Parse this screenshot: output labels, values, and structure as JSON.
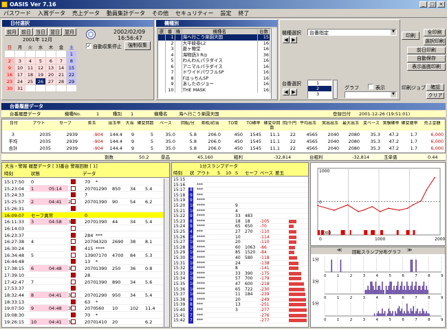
{
  "app": {
    "title": "OASIS Ver 7.16"
  },
  "menu": [
    "パスワード",
    "入賞データ",
    "売上データ",
    "動員集計データ",
    "その他",
    "セキュリティー",
    "設定",
    "終了"
  ],
  "cal_panel": {
    "title": "日付選択",
    "buttons": [
      "前月",
      "前日",
      "当日",
      "翌日",
      "翌月"
    ],
    "month": "2001年 12月",
    "dows": [
      "日",
      "月",
      "火",
      "水",
      "木",
      "金",
      "土"
    ],
    "weeks": [
      [
        "",
        "",
        "",
        "",
        "",
        "",
        "1"
      ],
      [
        "2",
        "3",
        "4",
        "5",
        "6",
        "7",
        "8"
      ],
      [
        "9",
        "10",
        "11",
        "12",
        "13",
        "14",
        "15"
      ],
      [
        "16",
        "17",
        "18",
        "19",
        "20",
        "21",
        "22"
      ],
      [
        "23",
        "24",
        "25",
        "26",
        "27",
        "28",
        "29"
      ],
      [
        "30",
        "31",
        "",
        "",
        "",
        "",
        ""
      ]
    ],
    "date": "2002/02/09",
    "time": "16:56:47",
    "auto_label": "自動収集停止",
    "manual_btn": "強制収集"
  },
  "machine_panel": {
    "title": "機種別",
    "headers": [
      "選",
      "番",
      "機",
      "機種名",
      "台数"
    ],
    "rows": [
      [
        "",
        "1",
        "",
        "海へ行こう楽園天国",
        "15"
      ],
      [
        "",
        "2",
        "",
        "大平綾巻L2",
        "16"
      ],
      [
        "",
        "3",
        "",
        "蒼ヶ穂堂",
        "16"
      ],
      [
        "",
        "4",
        "",
        "海物語3 R◎",
        "36"
      ],
      [
        "",
        "5",
        "",
        "わんわんパラダイス",
        "16"
      ],
      [
        "",
        "6",
        "",
        "アニマルパラダイス",
        "16"
      ],
      [
        "",
        "7",
        "",
        "ドワイドパワフルSP",
        "16"
      ],
      [
        "",
        "8",
        "",
        "FはっちんSP",
        "16"
      ],
      [
        "",
        "9",
        "",
        "あしたのジョー",
        "16"
      ],
      [
        "",
        "10",
        "",
        "THE MASK",
        "16"
      ]
    ]
  },
  "filter_panel": {
    "model_label": "機種選択",
    "model_value": "台番指定",
    "machine_label": "台番選択",
    "graph_label": "グラフ",
    "display_label": "表示",
    "machine_values": [
      "1",
      "2",
      "3"
    ]
  },
  "right_buttons": [
    "印刷",
    "全印刷",
    "選択印刷",
    "前日印刷",
    "自動保存",
    "表示画面印刷",
    "印刷ジョブ",
    "確認",
    "クリア"
  ],
  "history_title": "台番履歴データ",
  "summary": {
    "label1": "台番履歴データ",
    "mno_label": "機種No.",
    "mno": "1",
    "type_label": "種別",
    "type": "1",
    "name_label": "機種名",
    "name": "海へ行こう楽園天国",
    "date_label": "登録日付",
    "date": "2001-12-26 (19:51:01)"
  },
  "sum_headers": [
    "日付",
    "アウト",
    "セーフ",
    "差玉",
    "出玉率",
    "大当",
    "確変回数",
    "ベース",
    "回転/分",
    "差枚/初当",
    "TO単",
    "TO確率",
    "確変中回数",
    "回/千円",
    "平均出玉",
    "実出出玉",
    "最大出玉",
    "変ベース",
    "実験確率",
    "確変継率",
    "売上金額"
  ],
  "sum_rows": [
    [
      "3",
      "2035",
      "2939",
      "-904",
      "144.4",
      "9",
      "5",
      "35.0",
      "5.8",
      "206.0",
      "450",
      "1545",
      "11.1",
      "22",
      "4565",
      "2040",
      "2080",
      "35.3",
      "47.2",
      "1.7",
      "6,000"
    ],
    [
      "平均",
      "2035",
      "2939",
      "-904",
      "144.4",
      "9",
      "5",
      "35.0",
      "5.8",
      "206.0",
      "450",
      "1545",
      "11.1",
      "22",
      "4565",
      "2040",
      "2080",
      "35.3",
      "47.2",
      "1.7",
      "6,000"
    ],
    [
      "合計",
      "2035",
      "2939",
      "-904",
      "144.4",
      "9",
      "5",
      "35.0",
      "5.8",
      "206.0",
      "450",
      "1545",
      "11.1",
      "22",
      "4565",
      "2040",
      "2080",
      "35.3",
      "47.2",
      "1.7",
      "6,000"
    ]
  ],
  "footer": {
    "a": "割数",
    "a_val": "50.2",
    "b": "景品",
    "b_val": "45,160",
    "c": "粗利",
    "c_val": "-32,814",
    "d": "台粗利",
    "d_val": "-32,814",
    "e": "玉単価",
    "e_val": "0.44"
  },
  "events": {
    "title": "大当・警報 履歴データ [ 3]番台 警報回数 [ 1]",
    "headers": [
      "時刻",
      "状態",
      "",
      "",
      "",
      "データ",
      "",
      "",
      "",
      "",
      ""
    ],
    "rows": [
      [
        "15:17:50",
        "0",
        "",
        "",
        "",
        "70",
        "*",
        "",
        "",
        "",
        ""
      ],
      [
        "15:23:04",
        "1",
        "05:14",
        "",
        "",
        "2070",
        "1290",
        "850",
        "34",
        "5.4"
      ],
      [
        "15:24:33",
        "",
        "",
        "",
        "",
        "7",
        "",
        "",
        "",
        "",
        ""
      ],
      [
        "15:25:57",
        "2",
        "04:41",
        "2m",
        "",
        "2070",
        "1390",
        "90",
        "54",
        "6.2"
      ],
      [
        "15:26:31",
        "",
        "",
        "",
        "",
        "",
        "",
        "",
        "",
        "",
        ""
      ],
      [
        "16:09:07",
        "セーフ異常",
        "",
        "",
        "",
        "0",
        "",
        "",
        "",
        "",
        ""
      ],
      [
        "16:11:33",
        "3",
        "04:58",
        "3m",
        "",
        "2070",
        "1390",
        "44",
        "34",
        "5.4"
      ],
      [
        "16:14:03",
        "",
        "",
        "",
        "",
        "",
        "",
        "",
        "",
        "",
        ""
      ],
      [
        "16:23:37",
        "",
        "",
        "",
        "",
        "284",
        "***",
        "",
        "",
        "",
        ""
      ],
      [
        "16:27:38",
        "4",
        "",
        "",
        "",
        "2070",
        "4320",
        "2690",
        "38",
        "8.1"
      ],
      [
        "16:30:24",
        "",
        "",
        "",
        "",
        "415",
        "****",
        "",
        "",
        "",
        ""
      ],
      [
        "16:34:48",
        "5",
        "",
        "",
        "",
        "1390",
        "7170",
        "4700",
        "84",
        "5.3"
      ],
      [
        "16:44:48",
        "",
        "",
        "",
        "",
        "13",
        "*",
        "",
        "",
        "",
        ""
      ],
      [
        "17:38:15",
        "6",
        "04:48",
        "3m",
        "",
        "2070",
        "1390",
        "250",
        "36",
        "0.8"
      ],
      [
        "17:39:10",
        "",
        "",
        "",
        "",
        "28",
        "",
        "",
        "",
        "",
        ""
      ],
      [
        "17:42:47",
        "7",
        "",
        "",
        "",
        "2070",
        "1390",
        "890",
        "34",
        "5.6"
      ],
      [
        "17:53:37",
        "",
        "",
        "",
        "",
        "",
        "",
        "",
        "",
        "",
        ""
      ],
      [
        "18:32:44",
        "8",
        "04:41",
        "3m",
        "",
        "2070",
        "1290",
        "950",
        "34",
        "5.4"
      ],
      [
        "18:33:13",
        "",
        "",
        "",
        "",
        "63",
        "*",
        "",
        "",
        "",
        ""
      ],
      [
        "19:07:50",
        "9",
        "04:48",
        "3m",
        "",
        "2070",
        "560",
        "10",
        "102",
        "11.4"
      ],
      [
        "19:08:30",
        "",
        "",
        "",
        "",
        "70",
        "*",
        "",
        "",
        "",
        ""
      ],
      [
        "19:26:15",
        "10",
        "04:41",
        "3m",
        "",
        "2070",
        "1410",
        "20",
        "",
        "6.2"
      ]
    ],
    "alert_index": 5
  },
  "slump": {
    "title": "1分スランプデータ",
    "headers": [
      "時刻",
      "状",
      "アウト",
      "5",
      "10",
      "S",
      "セーフ",
      "ベース",
      "差玉"
    ],
    "rows": [
      [
        "15:15",
        "1",
        "",
        "",
        "",
        "",
        "",
        "",
        ""
      ],
      [
        "15:16",
        "8",
        "***",
        "",
        "",
        "",
        "",
        "",
        ""
      ],
      [
        "15:17",
        "8",
        "***",
        "",
        "",
        "",
        "",
        "",
        ""
      ],
      [
        "15:18",
        "9",
        "***",
        "",
        "",
        "",
        "",
        "",
        ""
      ],
      [
        "15:19",
        "9",
        "****",
        "",
        "",
        "",
        "",
        "",
        ""
      ],
      [
        "15:20",
        "10",
        "****",
        "",
        "",
        "9",
        "",
        "",
        ""
      ],
      [
        "15:21",
        "10",
        "****",
        "",
        "",
        "4",
        "",
        "",
        ""
      ],
      [
        "15:22",
        "9",
        "****",
        "",
        "",
        "33",
        "483",
        "",
        ""
      ],
      [
        "15:23",
        "8",
        "****",
        "",
        "",
        "18",
        "18",
        "-105",
        ""
      ],
      [
        "15:24",
        "9",
        "****",
        "",
        "",
        "65",
        "650",
        "-70",
        ""
      ],
      [
        "15:25",
        "4",
        "***",
        "",
        "",
        "27",
        "270",
        "-110",
        ""
      ],
      [
        "15:26",
        "10",
        "****",
        "",
        "",
        "10",
        "",
        "-114",
        ""
      ],
      [
        "15:27",
        "10",
        "****",
        "",
        "",
        "20",
        "",
        "-110",
        ""
      ],
      [
        "15:28",
        "10",
        "****",
        "",
        "",
        "60",
        "1063",
        "-86",
        ""
      ],
      [
        "15:29",
        "10",
        "****",
        "",
        "",
        "85",
        "1520",
        "-84",
        ""
      ],
      [
        "15:30",
        "10",
        "****",
        "",
        "",
        "40",
        "580",
        "-118",
        ""
      ],
      [
        "15:31",
        "10",
        "****",
        "",
        "",
        "24",
        "",
        "-138",
        ""
      ],
      [
        "15:32",
        "10",
        "****",
        "",
        "",
        "8",
        "",
        "-141",
        ""
      ],
      [
        "15:33",
        "10",
        "****",
        "",
        "",
        "33",
        "390",
        "-175",
        ""
      ],
      [
        "15:34",
        "10",
        "****",
        "",
        "",
        "57",
        "700",
        "-179",
        ""
      ],
      [
        "15:35",
        "10",
        "****",
        "",
        "",
        "47",
        "600",
        "-218",
        ""
      ],
      [
        "15:36",
        "10",
        "****",
        "",
        "",
        "65",
        "722",
        "-230",
        ""
      ],
      [
        "15:37",
        "10",
        "****",
        "",
        "",
        "11",
        "184",
        "-239",
        ""
      ],
      [
        "15:38",
        "9",
        "****",
        "",
        "",
        "20",
        "",
        "-249",
        ""
      ],
      [
        "15:39",
        "8",
        "***",
        "",
        "",
        "13",
        "",
        "-251",
        ""
      ],
      [
        "15:40",
        "7",
        "***",
        "",
        "",
        "3",
        "",
        "-277",
        ""
      ],
      [
        "15:41",
        "7",
        "***",
        "",
        "",
        "",
        "",
        "-276",
        ""
      ],
      [
        "15:42",
        "7",
        "***",
        "",
        "",
        "",
        "",
        "-277",
        ""
      ]
    ]
  },
  "top_chart": {
    "ylim_labels": [
      "1000",
      "0",
      "-1000"
    ],
    "x_labels": [
      "0",
      "1000",
      "2000"
    ],
    "series": [
      {
        "name": "差玉",
        "x": [
          0,
          60,
          110,
          150,
          170,
          200,
          230,
          260,
          300,
          330,
          350,
          380,
          400,
          430
        ],
        "y": [
          -120,
          -260,
          -100,
          -300,
          -250,
          -150,
          -300,
          -200,
          -260,
          -200,
          -100,
          20,
          350,
          720
        ]
      }
    ]
  },
  "dist": {
    "title": "回転スランプ分布グラフ",
    "rows": [
      {
        "label": "1分",
        "values": [
          0,
          0,
          0,
          0,
          0,
          1,
          0,
          0,
          0,
          0,
          0,
          0,
          1,
          0,
          0,
          0,
          0,
          0,
          0,
          0,
          0,
          0,
          0,
          0,
          0,
          0,
          0,
          0,
          0,
          0,
          0,
          0,
          0,
          0,
          0,
          0,
          0,
          0,
          0,
          0,
          0,
          0,
          0,
          0,
          0,
          0,
          0,
          0,
          0,
          0,
          0,
          0,
          0,
          0,
          0,
          0,
          0,
          0,
          0,
          0,
          0,
          0,
          0,
          0,
          0,
          0,
          1,
          1,
          0,
          0,
          1,
          0,
          0,
          0,
          0,
          0,
          0,
          0,
          0,
          0,
          0,
          0,
          0,
          0,
          0,
          0,
          0,
          0,
          0,
          0
        ]
      },
      {
        "label": "3分",
        "values": [
          0,
          0,
          0,
          0,
          0,
          0,
          0,
          0,
          0,
          0,
          0,
          0,
          0,
          0,
          0,
          0,
          0,
          0,
          0,
          0,
          0,
          0,
          0,
          0,
          0,
          0,
          0,
          0,
          0,
          0,
          0,
          1,
          1,
          2,
          1,
          3,
          3,
          2,
          1,
          3,
          1,
          2,
          2,
          1,
          3,
          1,
          0,
          2,
          1,
          2,
          3,
          3,
          1,
          2,
          1,
          2,
          3,
          1,
          2,
          3,
          1,
          2,
          1,
          3,
          2,
          1,
          2,
          3,
          1,
          2,
          3,
          1,
          2,
          2,
          1,
          2,
          3,
          1,
          2,
          1,
          0,
          0,
          0,
          0,
          0,
          0,
          0,
          0,
          0,
          0
        ]
      },
      {
        "label": "5分",
        "values": [
          0,
          0,
          0,
          0,
          0,
          0,
          0,
          0,
          0,
          0,
          0,
          0,
          0,
          0,
          0,
          0,
          0,
          0,
          0,
          0,
          0,
          0,
          0,
          0,
          0,
          0,
          0,
          0,
          0,
          0,
          0,
          0,
          0,
          0,
          0,
          0,
          0,
          0,
          1,
          0,
          1,
          2,
          1,
          1,
          3,
          1,
          2,
          0,
          1,
          3,
          2,
          1,
          2,
          0,
          2,
          1,
          3,
          4,
          2,
          3,
          1,
          2,
          1,
          5,
          2,
          1,
          3,
          2,
          4,
          1,
          2,
          3,
          1,
          2,
          1,
          3,
          2,
          1,
          2,
          1,
          1,
          0,
          0,
          0,
          0,
          0,
          0,
          0,
          0,
          0
        ]
      }
    ],
    "x_labels": [
      "0",
      "1",
      "2",
      "3",
      "4",
      "5",
      "6",
      "7",
      "8",
      "9"
    ]
  },
  "colors": {
    "accent": "#0a246a",
    "alert": "#ffff00",
    "red": "#c00000",
    "blue": "#0000c0"
  }
}
